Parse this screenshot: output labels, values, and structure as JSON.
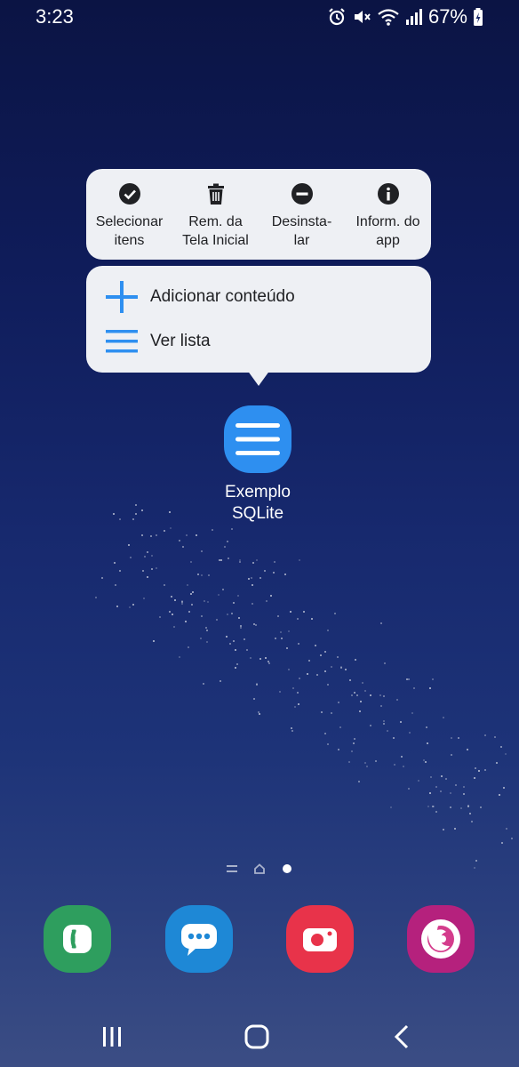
{
  "status_bar": {
    "time": "3:23",
    "battery": "67%",
    "icons": [
      "alarm-icon",
      "mute-icon",
      "wifi-icon",
      "signal-icon",
      "battery-charging-icon"
    ]
  },
  "popup": {
    "actions": [
      {
        "label": "Selecionar\nitens",
        "icon": "check-circle-icon"
      },
      {
        "label": "Rem. da\nTela Inicial",
        "icon": "trash-icon"
      },
      {
        "label": "Desinsta-\nlar",
        "icon": "minus-circle-icon"
      },
      {
        "label": "Inform. do\napp",
        "icon": "info-icon"
      }
    ],
    "shortcuts": [
      {
        "label": "Adicionar conteúdo",
        "icon": "plus-icon"
      },
      {
        "label": "Ver lista",
        "icon": "list-icon"
      }
    ]
  },
  "app": {
    "name": "Exemplo\nSQLite",
    "icon": "list-app-icon",
    "color": "#2e8ff0"
  },
  "page_indicator": {
    "pages": [
      "list-page-icon",
      "home-page-icon",
      "dot-page-icon"
    ],
    "active_index": 2
  },
  "dock": [
    {
      "name": "Telefone",
      "icon": "phone-icon",
      "color": "#2e9e5e"
    },
    {
      "name": "Mensagens",
      "icon": "messages-icon",
      "color": "#1e88d6"
    },
    {
      "name": "Câmera",
      "icon": "camera-icon",
      "color": "#e8334a"
    },
    {
      "name": "Firefox",
      "icon": "firefox-icon",
      "color": "#b5217d"
    }
  ],
  "nav_bar": {
    "buttons": [
      "recents-button",
      "home-button",
      "back-button"
    ]
  },
  "colors": {
    "accent": "#2e8ff0",
    "card_bg": "#eef0f4",
    "text_dark": "#202124"
  }
}
